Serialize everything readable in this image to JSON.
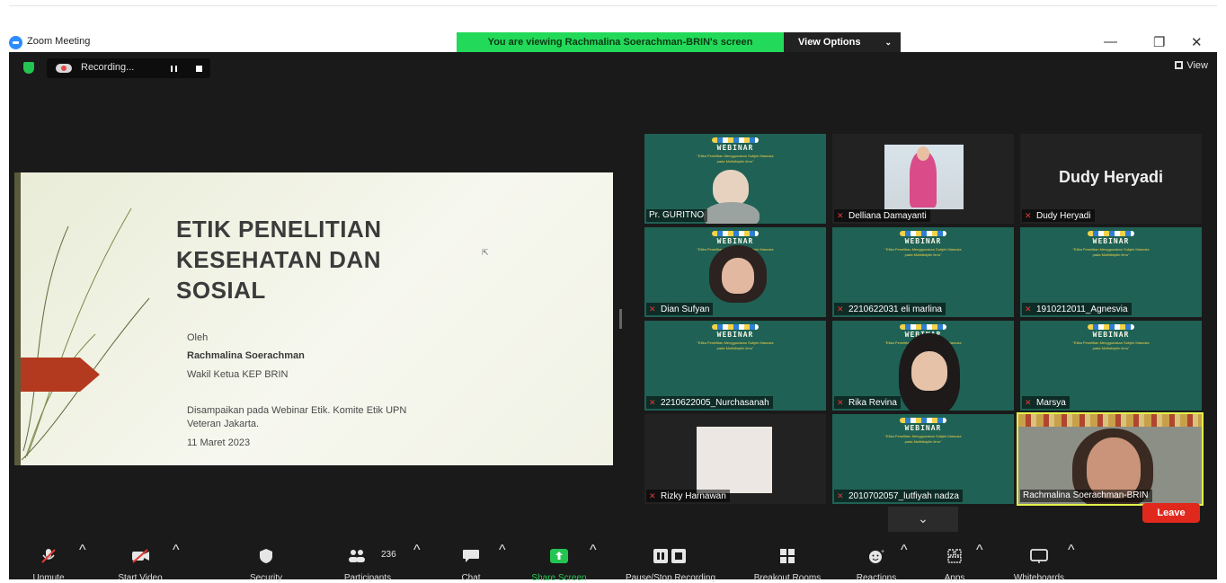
{
  "window": {
    "app_title": "Zoom Meeting",
    "banner": "You are viewing Rachmalina Soerachman-BRIN's screen",
    "view_options": "View Options",
    "minimize": "—",
    "restore": "❐",
    "close": "✕"
  },
  "top": {
    "recording_label": "Recording...",
    "view_label": "View"
  },
  "slide": {
    "title_line1": "ETIK PENELITIAN",
    "title_line2": "KESEHATAN DAN",
    "title_line3": "SOSIAL",
    "by_label": "Oleh",
    "presenter": "Rachmalina Soerachman",
    "role": "Wakil Ketua KEP BRIN",
    "event_line1": "Disampaikan pada Webinar Etik. Komite Etik UPN",
    "event_line2": "Veteran Jakarta.",
    "date": "11 Maret 2023"
  },
  "webinar_bg": {
    "heading": "WEBINAR",
    "sub_line1": "\"Etika Penelitian Menggunakan Subjek Manusia",
    "sub_line2": "pada Multidisiplin Ilmu\""
  },
  "participants": [
    {
      "name": "Pr. GURITNO",
      "muted": false
    },
    {
      "name": "Delliana Damayanti",
      "muted": true
    },
    {
      "name": "Dudy Heryadi",
      "muted": true,
      "display_name": "Dudy Heryadi"
    },
    {
      "name": "Dian Sufyan",
      "muted": true
    },
    {
      "name": "2210622031 eli marlina",
      "muted": true
    },
    {
      "name": "1910212011_Agnesvia",
      "muted": true
    },
    {
      "name": "2210622005_Nurchasanah",
      "muted": true
    },
    {
      "name": "Rika Revina",
      "muted": true
    },
    {
      "name": "Marsya",
      "muted": true
    },
    {
      "name": "Rizky Harnawan",
      "muted": true
    },
    {
      "name": "2010702057_lutfiyah nadza",
      "muted": true
    },
    {
      "name": "Rachmalina Soerachman-BRIN",
      "muted": false,
      "active_speaker": true
    }
  ],
  "scroll_icon": "chevron-down-icon",
  "toolbar": {
    "unmute": "Unmute",
    "start_video": "Start Video",
    "security": "Security",
    "participants": "Participants",
    "participants_count": "236",
    "chat": "Chat",
    "share_screen": "Share Screen",
    "pause_recording": "Pause/Stop Recording",
    "breakout_rooms": "Breakout Rooms",
    "reactions": "Reactions",
    "apps": "Apps",
    "whiteboards": "Whiteboards",
    "leave": "Leave"
  },
  "colors": {
    "banner_green": "#23d959",
    "tile_teal": "#1f6155",
    "leave_red": "#e0291c",
    "active_speaker_outline": "#e3f24a",
    "share_green": "#23c552"
  }
}
